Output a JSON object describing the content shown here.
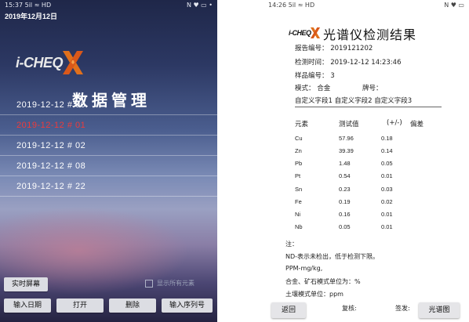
{
  "left": {
    "status": {
      "time": "15:37",
      "signal": "5il ≈ HD",
      "right": "N ♥ ▭ •"
    },
    "header_date": "2019年12月12日",
    "logo_text": "i-CHEQ",
    "title": "数据管理",
    "records": [
      {
        "label": "2019-12-12 # 00",
        "selected": false
      },
      {
        "label": "2019-12-12 # 01",
        "selected": true
      },
      {
        "label": "2019-12-12 # 02",
        "selected": false
      },
      {
        "label": "2019-12-12 # 08",
        "selected": false
      },
      {
        "label": "2019-12-12 # 22",
        "selected": false
      }
    ],
    "realtime_button": "实时屏幕",
    "show_all_label": "显示所有元素",
    "buttons": {
      "input_date": "输入日期",
      "open": "打开",
      "delete": "删除",
      "input_serial": "输入序列号"
    },
    "colors": {
      "selected": "#ee3b3b",
      "logo_x": "#e0701c"
    }
  },
  "right": {
    "status": {
      "time": "14:26",
      "signal": "5il ≈ HD",
      "right": "N ♥ ▭"
    },
    "logo_text": "i-CHEQ",
    "title": "光谱仪检测结果",
    "info": {
      "report_no": "报告编号： 2019121202",
      "test_time": "检测时间： 2019-12-12 14:23:46",
      "sample_no": "样品编号： 3",
      "mode": "模式： 合金",
      "grade": "牌号：",
      "custom": "自定义字段1 自定义字段2 自定义字段3"
    },
    "headers": {
      "element": "元素",
      "value": "测试值",
      "dev_sign": "(+/-)",
      "dev": "偏差"
    },
    "rows": [
      {
        "el": "Cu",
        "val": "57.96",
        "dev": "0.18"
      },
      {
        "el": "Zn",
        "val": "39.39",
        "dev": "0.14"
      },
      {
        "el": "Pb",
        "val": "1.48",
        "dev": "0.05"
      },
      {
        "el": "Pt",
        "val": "0.54",
        "dev": "0.01"
      },
      {
        "el": "Sn",
        "val": "0.23",
        "dev": "0.03"
      },
      {
        "el": "Fe",
        "val": "0.19",
        "dev": "0.02"
      },
      {
        "el": "Ni",
        "val": "0.16",
        "dev": "0.01"
      },
      {
        "el": "Nb",
        "val": "0.05",
        "dev": "0.01"
      }
    ],
    "notes": [
      "注：",
      "ND-表示未检出，低于检测下限。",
      "PPM-mg/kg,",
      "合金、矿石模式单位为：%",
      "土壤模式单位：ppm"
    ],
    "sign": {
      "review": "复核:",
      "issue": "签发:"
    },
    "back_button": "返回",
    "spectrum_button": "光谱图"
  }
}
